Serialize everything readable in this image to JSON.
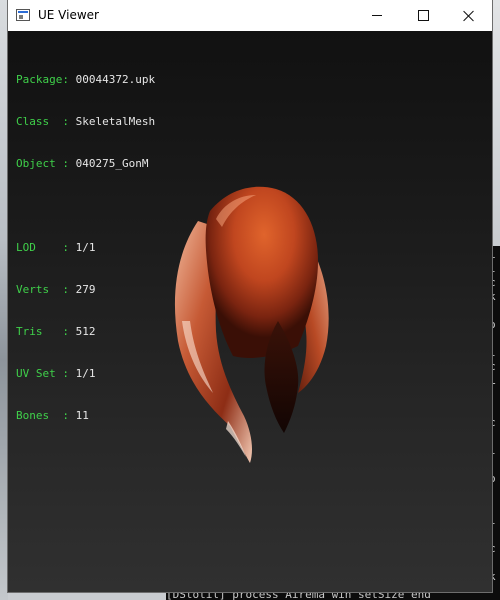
{
  "window": {
    "title": "UE Viewer",
    "controls": {
      "minimize": "minimize",
      "maximize": "maximize",
      "close": "close"
    }
  },
  "info": {
    "package": {
      "label": "Package:",
      "value": "00044372.upk"
    },
    "class": {
      "label": "Class  :",
      "value": "SkeletalMesh"
    },
    "object": {
      "label": "Object :",
      "value": "040275_GonM"
    },
    "lod": {
      "label": "LOD    :",
      "value": "1/1"
    },
    "verts": {
      "label": "Verts  :",
      "value": "279"
    },
    "tris": {
      "label": "Tris   :",
      "value": "512"
    },
    "uvset": {
      "label": "UV Set :",
      "value": "1/1"
    },
    "bones": {
      "label": "Bones  :",
      "value": "11"
    }
  },
  "background": {
    "console_bottom_line": "[DStotil] process  Airema win setSize  end",
    "console_side_glyphs": "i\nl\nc\nk\n \no\n:\nl\nc\nL\n:\n:\nc\n:\nl\n:\no\n:\n:\nl\n:\nc\n:\nk\n:"
  },
  "colors": {
    "label_green": "#3fd04a",
    "viewport_top": "#111111",
    "viewport_bottom": "#303030",
    "mesh_orange": "#c0461f"
  }
}
